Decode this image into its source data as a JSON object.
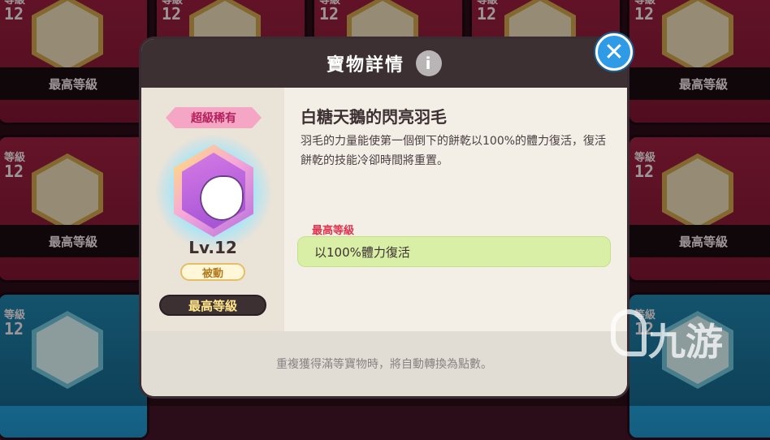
{
  "background_cards": {
    "level_caption": "等級",
    "level_value": "12",
    "max_level_label": "最高等級"
  },
  "modal": {
    "title": "寶物詳情",
    "info_icon": "i",
    "rarity_label": "超級稀有",
    "level": "Lv.12",
    "type_badge": "被動",
    "max_level_button": "最高等級",
    "item_name": "白糖天鵝的閃亮羽毛",
    "item_description": "羽毛的力量能使第一個倒下的餅乾以100%的體力復活，復活餅乾的技能冷卻時間將重置。",
    "max_level_section_label": "最高等級",
    "max_level_effect": "以100%體力復活",
    "footer_note": "重複獲得滿等寶物時，將自動轉換為點數。",
    "close_icon": "close-icon"
  },
  "watermark": {
    "text": "九游"
  },
  "colors": {
    "header_bg": "#3d3033",
    "close_button": "#2f9be6",
    "rarity_pink": "#f4a6c4",
    "effect_green": "#d9efa6",
    "max_label_red": "#e0334f"
  }
}
